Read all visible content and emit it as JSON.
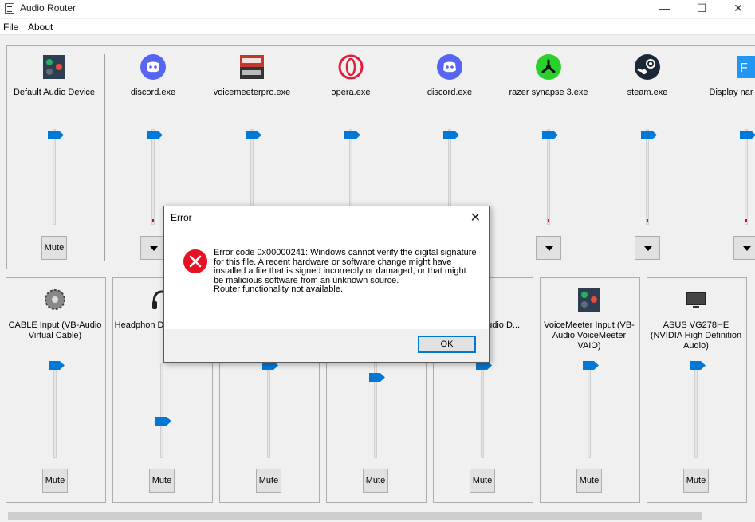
{
  "window": {
    "title": "Audio Router",
    "minimize": "—",
    "maximize": "☐",
    "close": "✕"
  },
  "menu": {
    "file": "File",
    "about": "About"
  },
  "apps": [
    {
      "label": "Default Audio Device",
      "icon": "voicemeeter-icon",
      "level": 0.8,
      "control": "Mute"
    },
    {
      "label": "discord.exe",
      "icon": "discord-icon",
      "level": 0.8
    },
    {
      "label": "voicemeeterpro.exe",
      "icon": "voicemeeter-pro-icon",
      "level": 0.8
    },
    {
      "label": "opera.exe",
      "icon": "opera-icon",
      "level": 0.8
    },
    {
      "label": "discord.exe",
      "icon": "discord-icon",
      "level": 0.8
    },
    {
      "label": "razer synapse 3.exe",
      "icon": "razer-icon",
      "level": 0.8
    },
    {
      "label": "steam.exe",
      "icon": "steam-icon",
      "level": 0.8
    },
    {
      "label": "Display nar availab",
      "icon": "app-icon",
      "level": 0.8
    }
  ],
  "outputs": [
    {
      "label": "CABLE Input (VB-Audio Virtual Cable)",
      "icon": "cable-icon",
      "level": 1.0,
      "mute": "Mute"
    },
    {
      "label": "Headphon Definitio Devi",
      "icon": "headphones-icon",
      "level": 0.3,
      "mute": "Mute"
    },
    {
      "label": "",
      "icon": "speaker-icon",
      "level": 1.0,
      "mute": "Mute"
    },
    {
      "label": "",
      "icon": "speaker-icon",
      "level": 0.85,
      "mute": "Mute"
    },
    {
      "label": "udio (High udio D...",
      "icon": "speaker-icon",
      "level": 1.0,
      "mute": "Mute"
    },
    {
      "label": "VoiceMeeter Input (VB-Audio VoiceMeeter VAIO)",
      "icon": "voicemeeter-icon",
      "level": 1.0,
      "mute": "Mute"
    },
    {
      "label": "ASUS VG278HE (NVIDIA High Definition Audio)",
      "icon": "monitor-icon",
      "level": 1.0,
      "mute": "Mute"
    }
  ],
  "dialog": {
    "title": "Error",
    "close": "✕",
    "message": "Error code 0x00000241: Windows cannot verify the digital signature for this file. A recent hardware or software change might have installed a file that is signed incorrectly or damaged, or that might be malicious software from an unknown source.",
    "message2": "Router functionality not available.",
    "ok": "OK"
  },
  "colors": {
    "thumb": "#0078d7",
    "error": "#e81123",
    "accent_border": "#0078d7"
  }
}
